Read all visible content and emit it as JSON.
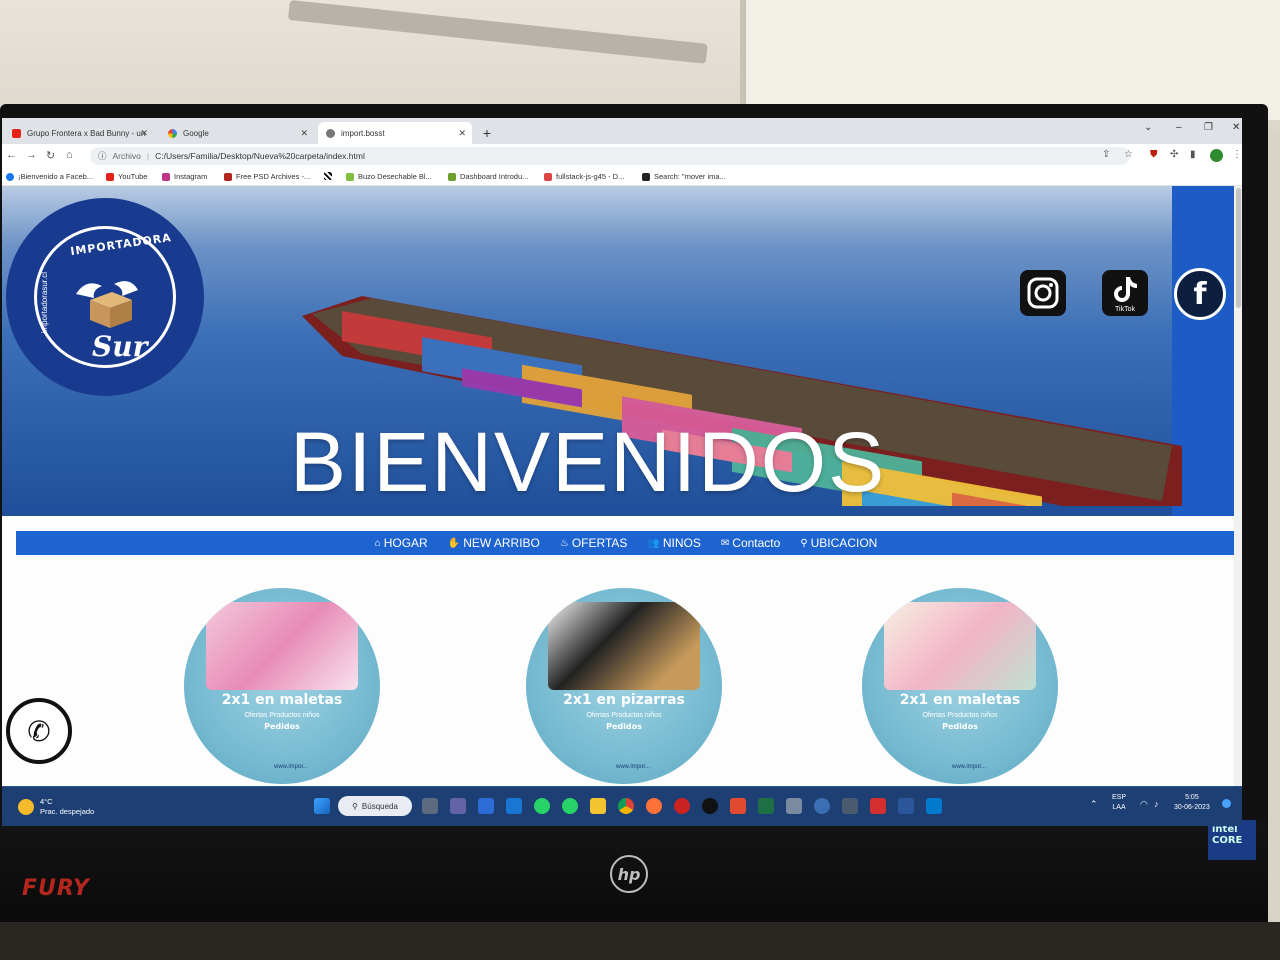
{
  "browser": {
    "tabs": [
      {
        "label": "Grupo Frontera x Bad Bunny - un",
        "favicon": "youtube-icon",
        "active": false
      },
      {
        "label": "Google",
        "favicon": "google-icon",
        "active": false
      },
      {
        "label": "import.bosst",
        "favicon": "globe-icon",
        "active": true
      }
    ],
    "address": {
      "scheme": "Archivo",
      "url": "C:/Users/Familia/Desktop/Nueva%20carpeta/index.html"
    },
    "bookmarks": [
      "¡Bienvenido a Faceb...",
      "YouTube",
      "Instagram",
      "Free PSD Archives -...",
      "",
      "Buzo Desechable Bl...",
      "Dashboard Introdu...",
      "fullstack-js-g45 - D...",
      "Search: \"mover ima..."
    ]
  },
  "site": {
    "logo": {
      "top_text": "IMPORTADORA",
      "brand": "Sur",
      "side_text": "importadorasur.cl"
    },
    "hero_title": "BIENVENIDOS",
    "social": {
      "tiktok_label": "TikTok",
      "facebook_glyph": "f"
    },
    "nav": [
      {
        "label": "HOGAR",
        "icon": "home-icon",
        "glyph": "⌂"
      },
      {
        "label": "NEW ARRIBO",
        "icon": "hand-icon",
        "glyph": "✋"
      },
      {
        "label": "OFERTAS",
        "icon": "fire-icon",
        "glyph": "♨"
      },
      {
        "label": "NINOS",
        "icon": "children-icon",
        "glyph": "👥"
      },
      {
        "label": "Contacto",
        "icon": "envelope-icon",
        "glyph": "✉"
      },
      {
        "label": "UBICACION",
        "icon": "map-pin-icon",
        "glyph": "⚲"
      }
    ],
    "promos": [
      {
        "title": "2x1 en maletas",
        "subtitle": "Ofertas Productos niños",
        "tag": "Pedidos",
        "url": "www.impor..."
      },
      {
        "title": "2x1 en pizarras",
        "subtitle": "Ofertas Productos niños",
        "tag": "Pedidos",
        "url": "www.impor..."
      },
      {
        "title": "2x1 en maletas",
        "subtitle": "Ofertas Productos niños",
        "tag": "Pedidos",
        "url": "www.impor..."
      }
    ]
  },
  "taskbar": {
    "weather_temp": "4°C",
    "weather_desc": "Prac. despejado",
    "search_label": "Búsqueda",
    "lang_line1": "ESP",
    "lang_line2": "LAA",
    "time": "5:05",
    "date": "30-06-2023"
  },
  "colors": {
    "nav_blue": "#1e64d0",
    "logo_navy": "#183a8f",
    "taskbar": "#1d3f73"
  }
}
